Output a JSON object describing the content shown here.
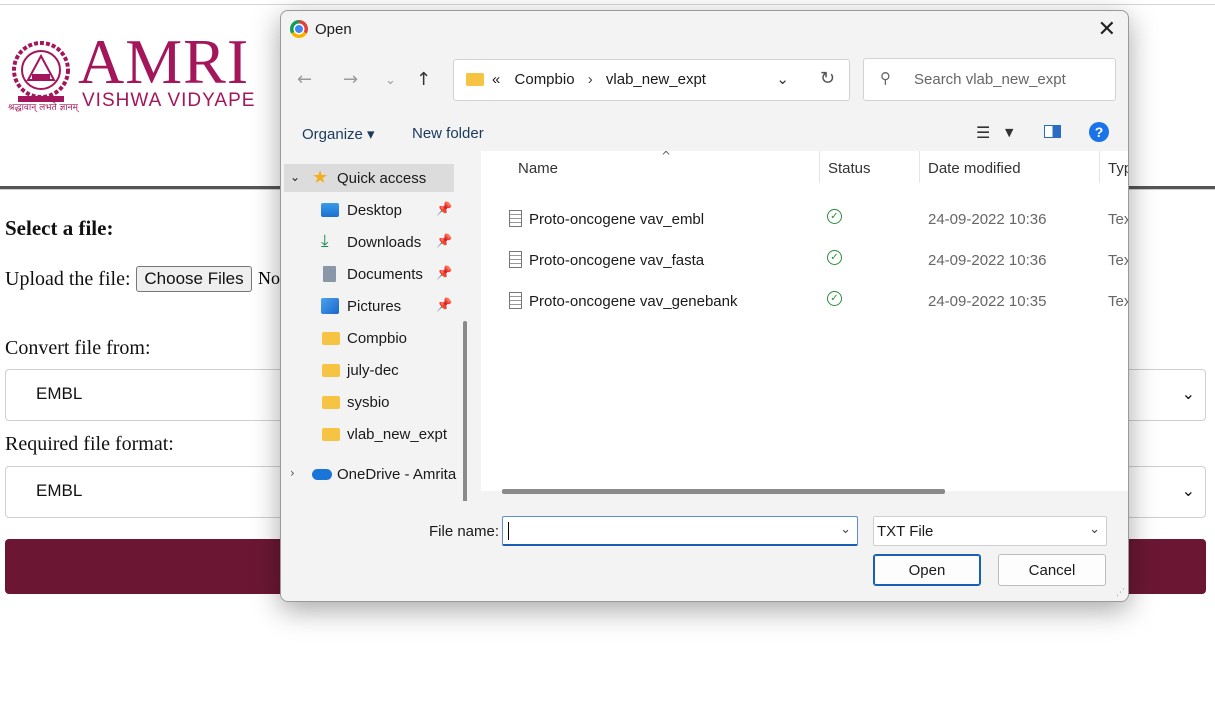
{
  "page": {
    "logo_main": "AMRI",
    "logo_sub": "VISHWA VIDYAPE",
    "logo_motto": "श्रद्धावान् लभते ज्ञानम्",
    "select_file_heading": "Select a file:",
    "upload_label": "Upload the file:",
    "choose_files_label": "Choose Files",
    "no_file_text": "No",
    "convert_from_label": "Convert file from:",
    "convert_from_value": "EMBL",
    "required_format_label": "Required file format:",
    "required_format_value": "EMBL",
    "brand_color": "#a4165b",
    "button_color": "#6b1733"
  },
  "dialog": {
    "title": "Open",
    "close_glyph": "✕",
    "address": {
      "overflow": "«",
      "crumbs": [
        "Compbio",
        "vlab_new_expt"
      ]
    },
    "search_placeholder": "Search vlab_new_expt",
    "toolbar": {
      "organize_label": "Organize ▾",
      "new_folder_label": "New folder"
    },
    "nav": {
      "quick_access": "Quick access",
      "items": [
        {
          "label": "Desktop",
          "icon": "desktop-icon",
          "pinned": true
        },
        {
          "label": "Downloads",
          "icon": "download-icon",
          "pinned": true
        },
        {
          "label": "Documents",
          "icon": "documents-icon",
          "pinned": true
        },
        {
          "label": "Pictures",
          "icon": "pictures-icon",
          "pinned": true
        },
        {
          "label": "Compbio",
          "icon": "folder-icon",
          "pinned": false
        },
        {
          "label": "july-dec",
          "icon": "folder-icon",
          "pinned": false
        },
        {
          "label": "sysbio",
          "icon": "folder-icon",
          "pinned": false
        },
        {
          "label": "vlab_new_expt",
          "icon": "folder-icon",
          "pinned": false
        }
      ],
      "onedrive": "OneDrive - Amrita"
    },
    "columns": [
      "Name",
      "Status",
      "Date modified",
      "Typ"
    ],
    "files": [
      {
        "name": "Proto-oncogene vav_embl",
        "status": "synced",
        "date": "24-09-2022 10:36",
        "type": "Tex"
      },
      {
        "name": "Proto-oncogene vav_fasta",
        "status": "synced",
        "date": "24-09-2022 10:36",
        "type": "Tex"
      },
      {
        "name": "Proto-oncogene vav_genebank",
        "status": "synced",
        "date": "24-09-2022 10:35",
        "type": "Tex"
      }
    ],
    "file_name_label": "File name:",
    "file_name_value": "",
    "file_type_value": "TXT File",
    "open_label": "Open",
    "cancel_label": "Cancel"
  }
}
